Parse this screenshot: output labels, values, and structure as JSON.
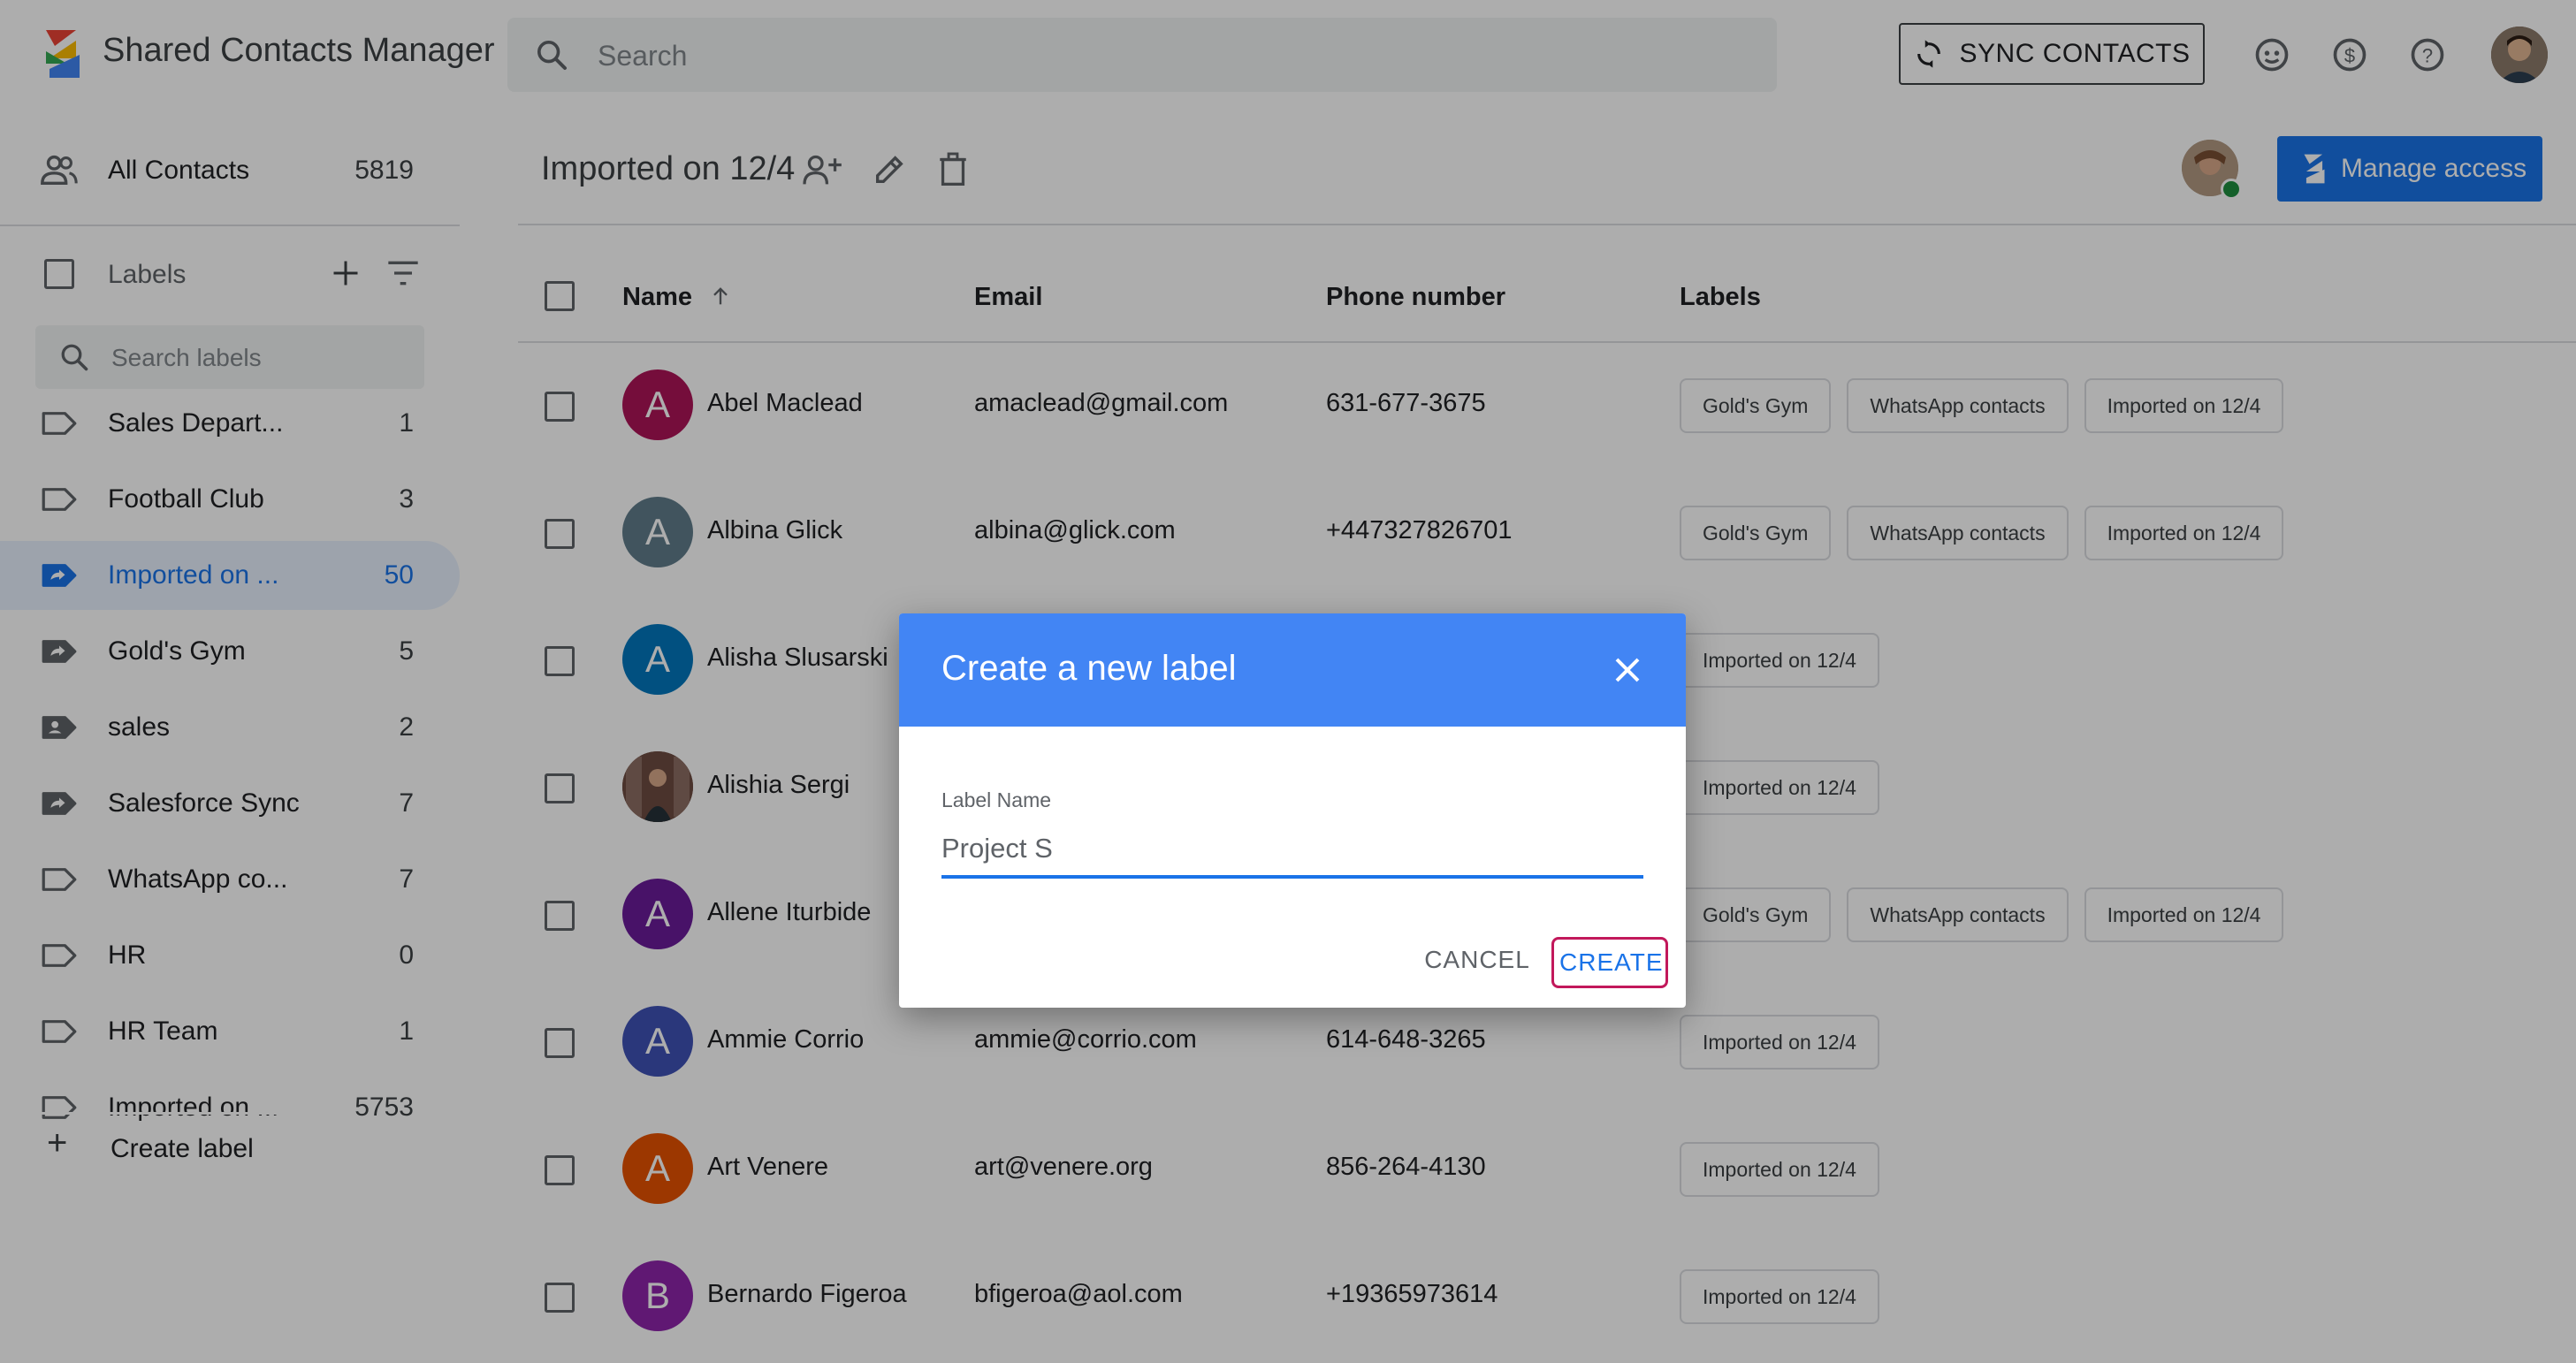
{
  "app": {
    "title": "Shared Contacts Manager",
    "search_placeholder": "Search",
    "sync_label": "SYNC CONTACTS"
  },
  "sidebar": {
    "all_contacts": {
      "label": "All Contacts",
      "count": "5819"
    },
    "labels_header": "Labels",
    "search_labels_placeholder": "Search labels",
    "items": [
      {
        "name": "Sales Depart...",
        "count": "1",
        "icon": "label-outline-icon"
      },
      {
        "name": "Football Club",
        "count": "3",
        "icon": "label-outline-icon"
      },
      {
        "name": "Imported on ...",
        "count": "50",
        "icon": "shared-label-icon",
        "active": true
      },
      {
        "name": "Gold's Gym",
        "count": "5",
        "icon": "shared-label-icon"
      },
      {
        "name": "sales",
        "count": "2",
        "icon": "contact-label-icon"
      },
      {
        "name": "Salesforce Sync",
        "count": "7",
        "icon": "shared-label-icon"
      },
      {
        "name": "WhatsApp co...",
        "count": "7",
        "icon": "label-outline-icon"
      },
      {
        "name": "HR",
        "count": "0",
        "icon": "label-outline-icon"
      },
      {
        "name": "HR Team",
        "count": "1",
        "icon": "label-outline-icon"
      },
      {
        "name": "Imported on ...",
        "count": "5753",
        "icon": "label-outline-icon"
      }
    ],
    "create_label": "Create label"
  },
  "main": {
    "title": "Imported on 12/4",
    "manage_access_label": "Manage access",
    "columns": {
      "name": "Name",
      "email": "Email",
      "phone": "Phone number",
      "labels": "Labels"
    },
    "rows": [
      {
        "initial": "A",
        "color": "#ad1457",
        "name": "Abel Maclead",
        "email": "amaclead@gmail.com",
        "phone": "631-677-3675",
        "labels": [
          "Gold's Gym",
          "WhatsApp contacts",
          "Imported on 12/4"
        ]
      },
      {
        "initial": "A",
        "color": "#607d8b",
        "name": "Albina Glick",
        "email": "albina@glick.com",
        "phone": "+447327826701",
        "labels": [
          "Gold's Gym",
          "WhatsApp contacts",
          "Imported on 12/4"
        ]
      },
      {
        "initial": "A",
        "color": "#0277bd",
        "name": "Alisha Slusarski",
        "email": "",
        "phone": "",
        "labels": [
          "Imported on 12/4"
        ]
      },
      {
        "initial": "",
        "color": "#6d4c41",
        "name": "Alishia Sergi",
        "email": "",
        "phone": "",
        "labels": [
          "Imported on 12/4"
        ],
        "photo": true
      },
      {
        "initial": "A",
        "color": "#6a1b9a",
        "name": "Allene Iturbide",
        "email": "",
        "phone": "",
        "labels": [
          "Gold's Gym",
          "WhatsApp contacts",
          "Imported on 12/4"
        ]
      },
      {
        "initial": "A",
        "color": "#3f51b5",
        "name": "Ammie Corrio",
        "email": "ammie@corrio.com",
        "phone": "614-648-3265",
        "labels": [
          "Imported on 12/4"
        ]
      },
      {
        "initial": "A",
        "color": "#e65100",
        "name": "Art Venere",
        "email": "art@venere.org",
        "phone": "856-264-4130",
        "labels": [
          "Imported on 12/4"
        ]
      },
      {
        "initial": "B",
        "color": "#8e24aa",
        "name": "Bernardo Figeroa",
        "email": "bfigeroa@aol.com",
        "phone": "+19365973614",
        "labels": [
          "Imported on 12/4"
        ]
      }
    ]
  },
  "dialog": {
    "title": "Create a new label",
    "field_label": "Label Name",
    "field_value": "Project S",
    "cancel_label": "CANCEL",
    "create_label": "CREATE"
  },
  "colors": {
    "accent": "#1a73e8",
    "dialog_header": "#4285f4",
    "highlight_border": "#c2185b"
  }
}
